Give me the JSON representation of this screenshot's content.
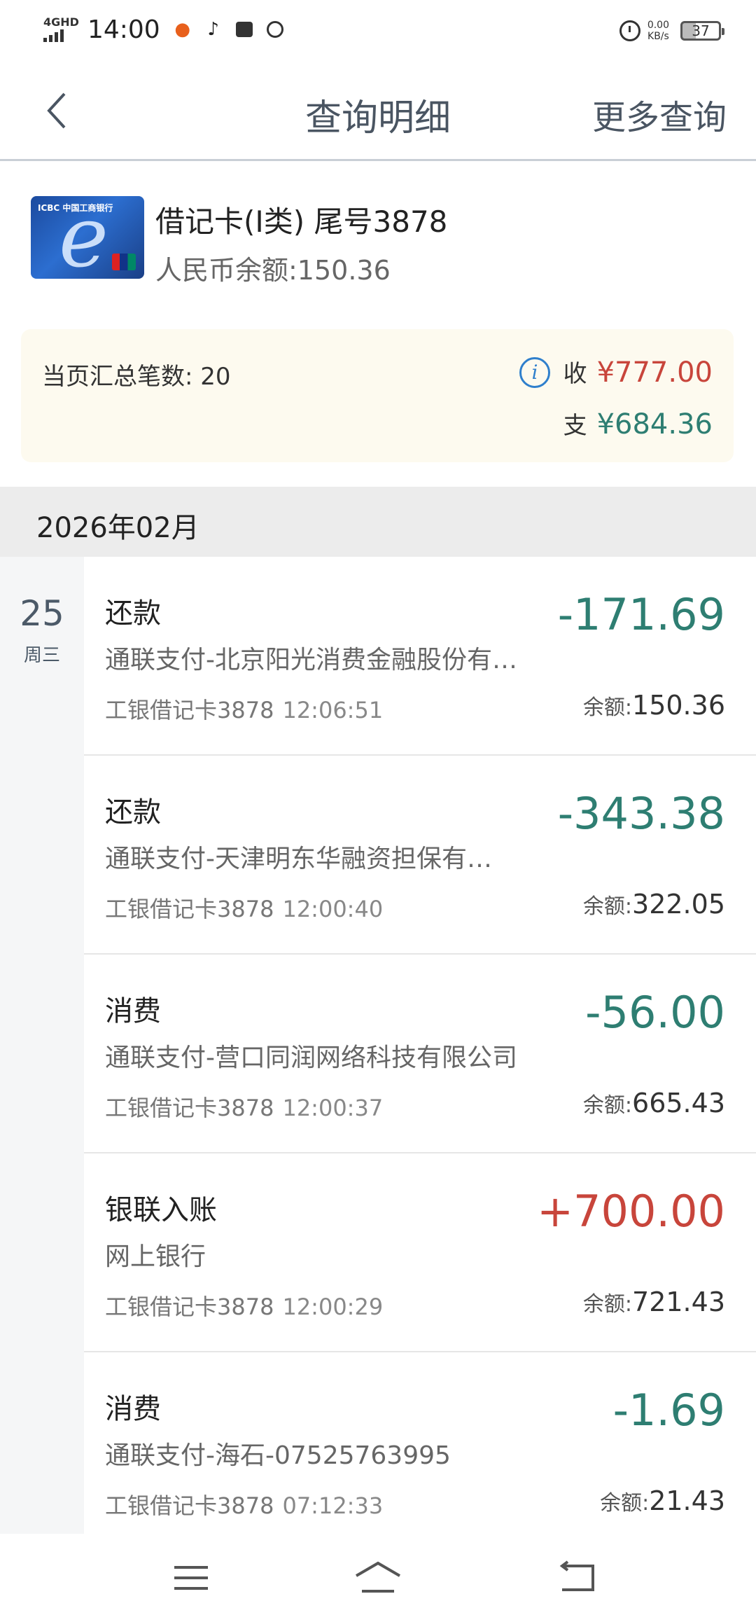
{
  "status": {
    "network": "4GHD",
    "time": "14:00",
    "speed_value": "0.00",
    "speed_unit": "KB/s",
    "battery": "37"
  },
  "header": {
    "title": "查询明细",
    "more": "更多查询"
  },
  "account": {
    "name": "借记卡(Ⅰ类) 尾号3878",
    "balance": "人民币余额:150.36",
    "card_logo": "ICBC 中国工商银行"
  },
  "summary": {
    "count_label": "当页汇总笔数: 20",
    "in_label": "收",
    "in_amount": "¥777.00",
    "out_label": "支",
    "out_amount": "¥684.36"
  },
  "month": "2026年02月",
  "day": {
    "date": "25",
    "weekday": "周三"
  },
  "balance_label": "余额:",
  "transactions": [
    {
      "type": "还款",
      "desc": "通联支付-北京阳光消费金融股份有…",
      "card": "工银借记卡3878",
      "time": "12:06:51",
      "amount": "-171.69",
      "balance": "150.36"
    },
    {
      "type": "还款",
      "desc": "通联支付-天津明东华融资担保有…",
      "card": "工银借记卡3878",
      "time": "12:00:40",
      "amount": "-343.38",
      "balance": "322.05"
    },
    {
      "type": "消费",
      "desc": "通联支付-营口同润网络科技有限公司",
      "card": "工银借记卡3878",
      "time": "12:00:37",
      "amount": "-56.00",
      "balance": "665.43"
    },
    {
      "type": "银联入账",
      "desc": "网上银行",
      "card": "工银借记卡3878",
      "time": "12:00:29",
      "amount": "+700.00",
      "balance": "721.43"
    },
    {
      "type": "消费",
      "desc": "通联支付-海石-07525763995",
      "card": "工银借记卡3878",
      "time": "07:12:33",
      "amount": "-1.69",
      "balance": "21.43"
    }
  ],
  "colors": {
    "negative": "#2e7e72",
    "positive": "#c8453b",
    "summary_bg": "#fdfaef",
    "accent": "#4a5562"
  },
  "icons": {
    "back": "chevron-left-icon",
    "info": "info-icon",
    "nav_menu": "menu-icon",
    "nav_home": "home-icon",
    "nav_back": "back-icon"
  }
}
